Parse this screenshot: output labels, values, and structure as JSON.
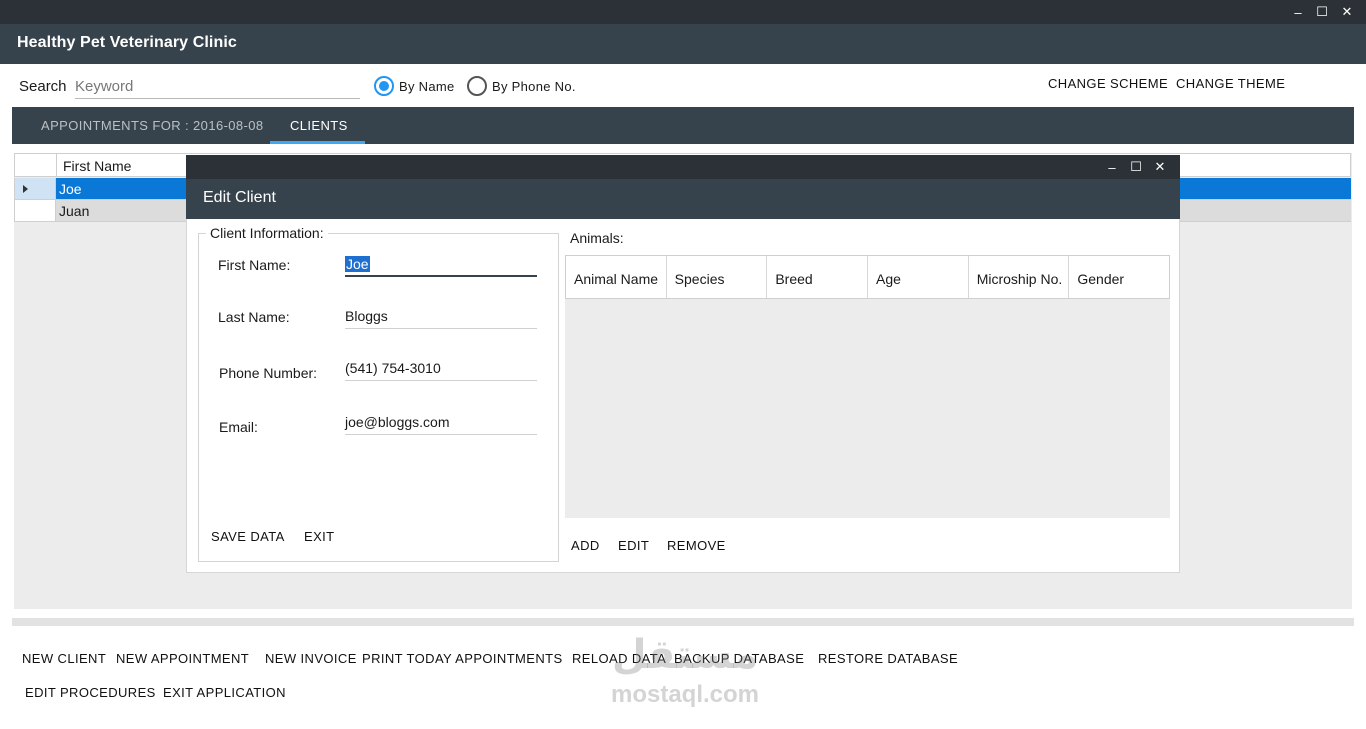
{
  "app": {
    "title": "Healthy Pet Veterinary Clinic",
    "window_controls": {
      "minimize": "–",
      "maximize": "☐",
      "close": "✕"
    }
  },
  "search": {
    "label": "Search",
    "placeholder": "Keyword",
    "options": [
      {
        "label": "By Name",
        "checked": true
      },
      {
        "label": "By Phone No.",
        "checked": false
      }
    ],
    "accent": "#2196f3"
  },
  "header_actions": {
    "change_scheme": "CHANGE SCHEME",
    "change_theme": "CHANGE THEME"
  },
  "tabs": [
    {
      "label": "APPOINTMENTS FOR : 2016-08-08",
      "active": false
    },
    {
      "label": "CLIENTS",
      "active": true
    }
  ],
  "clients_grid": {
    "columns": [
      "First Name"
    ],
    "rows": [
      {
        "first_name": "Joe",
        "selected": true
      },
      {
        "first_name": "Juan",
        "selected": false
      }
    ],
    "selection_color": "#0a78d7"
  },
  "edit_dialog": {
    "title": "Edit Client",
    "window_controls": {
      "minimize": "–",
      "maximize": "☐",
      "close": "✕"
    },
    "client_info": {
      "legend": "Client Information:",
      "fields": {
        "first_name": {
          "label": "First Name:",
          "value": "Joe"
        },
        "last_name": {
          "label": "Last Name:",
          "value": "Bloggs"
        },
        "phone": {
          "label": "Phone Number:",
          "value": "(541) 754-3010"
        },
        "email": {
          "label": "Email:",
          "value": "joe@bloggs.com"
        }
      },
      "save": "SAVE DATA",
      "exit": "EXIT"
    },
    "animals": {
      "label": "Animals:",
      "columns": [
        "Animal Name",
        "Species",
        "Breed",
        "Age",
        "Microship No.",
        "Gender"
      ],
      "rows": [],
      "add": "ADD",
      "edit": "EDIT",
      "remove": "REMOVE"
    }
  },
  "commands": {
    "row1": [
      "NEW CLIENT",
      "NEW APPOINTMENT",
      "NEW INVOICE",
      "PRINT TODAY APPOINTMENTS",
      "RELOAD DATA",
      "BACKUP DATABASE",
      "RESTORE DATABASE"
    ],
    "row2": [
      "EDIT PROCEDURES",
      "EXIT APPLICATION"
    ]
  },
  "watermark": {
    "arabic": "مستقل",
    "latin": "mostaql.com"
  }
}
